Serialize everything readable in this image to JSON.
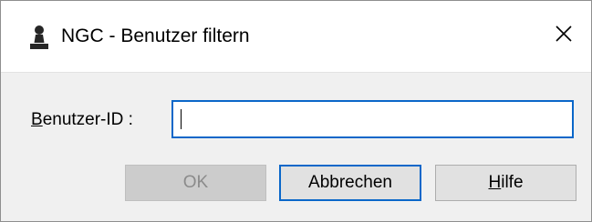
{
  "window": {
    "title": "NGC - Benutzer filtern",
    "icon": "chess-pawn-icon",
    "close_icon": "close-icon"
  },
  "form": {
    "user_id_label_accel": "B",
    "user_id_label_rest": "enutzer-ID :",
    "user_id_value": "",
    "user_id_placeholder": ""
  },
  "buttons": {
    "ok_label": "OK",
    "cancel_label": "Abbrechen",
    "help_label_accel": "H",
    "help_label_rest": "ilfe"
  },
  "colors": {
    "focus_accent": "#0a67c9",
    "disabled_text": "#8b8b8b",
    "dialog_background": "#f0f0f0"
  }
}
